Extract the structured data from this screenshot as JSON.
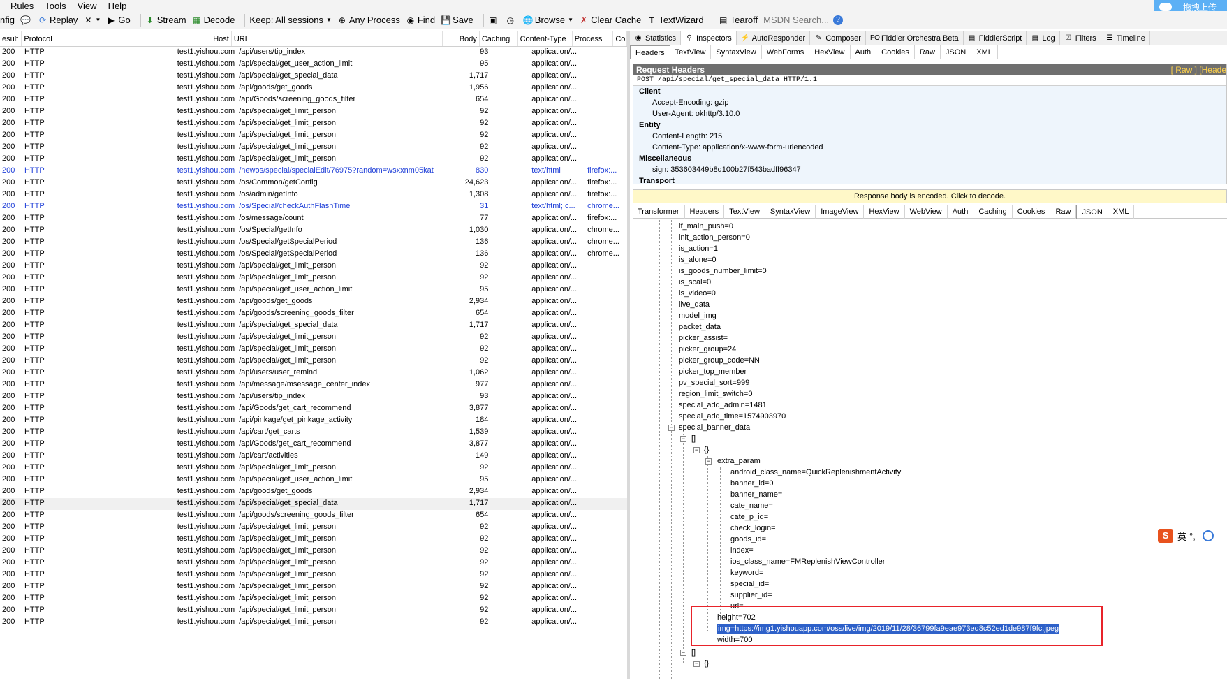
{
  "menu": [
    "Rules",
    "Tools",
    "View",
    "Help"
  ],
  "upload_label": "拖拽上传",
  "toolbar": {
    "config": "nfig",
    "replay": "Replay",
    "go": "Go",
    "stream": "Stream",
    "decode": "Decode",
    "keep": "Keep: All sessions",
    "process": "Any Process",
    "find": "Find",
    "save": "Save",
    "browse": "Browse",
    "clear_cache": "Clear Cache",
    "textwizard": "TextWizard",
    "tearoff": "Tearoff",
    "search_placeholder": "MSDN Search..."
  },
  "grid": {
    "headers": [
      "esult",
      "Protocol",
      "Host",
      "URL",
      "Body",
      "Caching",
      "Content-Type",
      "Process",
      "Cor"
    ],
    "rows": [
      [
        "200",
        "HTTP",
        "test1.yishou.com",
        "/api/users/tip_index",
        "93",
        "",
        "application/...",
        ""
      ],
      [
        "200",
        "HTTP",
        "test1.yishou.com",
        "/api/special/get_user_action_limit",
        "95",
        "",
        "application/...",
        ""
      ],
      [
        "200",
        "HTTP",
        "test1.yishou.com",
        "/api/special/get_special_data",
        "1,717",
        "",
        "application/...",
        ""
      ],
      [
        "200",
        "HTTP",
        "test1.yishou.com",
        "/api/goods/get_goods",
        "1,956",
        "",
        "application/...",
        ""
      ],
      [
        "200",
        "HTTP",
        "test1.yishou.com",
        "/api/Goods/screening_goods_filter",
        "654",
        "",
        "application/...",
        ""
      ],
      [
        "200",
        "HTTP",
        "test1.yishou.com",
        "/api/special/get_limit_person",
        "92",
        "",
        "application/...",
        ""
      ],
      [
        "200",
        "HTTP",
        "test1.yishou.com",
        "/api/special/get_limit_person",
        "92",
        "",
        "application/...",
        ""
      ],
      [
        "200",
        "HTTP",
        "test1.yishou.com",
        "/api/special/get_limit_person",
        "92",
        "",
        "application/...",
        ""
      ],
      [
        "200",
        "HTTP",
        "test1.yishou.com",
        "/api/special/get_limit_person",
        "92",
        "",
        "application/...",
        ""
      ],
      [
        "200",
        "HTTP",
        "test1.yishou.com",
        "/api/special/get_limit_person",
        "92",
        "",
        "application/...",
        ""
      ],
      [
        "200",
        "HTTP",
        "test1.yishou.com",
        "/newos/special/specialEdit/76975?random=wsxxnm05kat",
        "830",
        "",
        "text/html",
        "firefox:..."
      ],
      [
        "200",
        "HTTP",
        "test1.yishou.com",
        "/os/Common/getConfig",
        "24,623",
        "",
        "application/...",
        "firefox:..."
      ],
      [
        "200",
        "HTTP",
        "test1.yishou.com",
        "/os/admin/getInfo",
        "1,308",
        "",
        "application/...",
        "firefox:..."
      ],
      [
        "200",
        "HTTP",
        "test1.yishou.com",
        "/os/Special/checkAuthFlashTime",
        "31",
        "",
        "text/html; c...",
        "chrome..."
      ],
      [
        "200",
        "HTTP",
        "test1.yishou.com",
        "/os/message/count",
        "77",
        "",
        "application/...",
        "firefox:..."
      ],
      [
        "200",
        "HTTP",
        "test1.yishou.com",
        "/os/Special/getInfo",
        "1,030",
        "",
        "application/...",
        "chrome..."
      ],
      [
        "200",
        "HTTP",
        "test1.yishou.com",
        "/os/Special/getSpecialPeriod",
        "136",
        "",
        "application/...",
        "chrome..."
      ],
      [
        "200",
        "HTTP",
        "test1.yishou.com",
        "/os/Special/getSpecialPeriod",
        "136",
        "",
        "application/...",
        "chrome..."
      ],
      [
        "200",
        "HTTP",
        "test1.yishou.com",
        "/api/special/get_limit_person",
        "92",
        "",
        "application/...",
        ""
      ],
      [
        "200",
        "HTTP",
        "test1.yishou.com",
        "/api/special/get_limit_person",
        "92",
        "",
        "application/...",
        ""
      ],
      [
        "200",
        "HTTP",
        "test1.yishou.com",
        "/api/special/get_user_action_limit",
        "95",
        "",
        "application/...",
        ""
      ],
      [
        "200",
        "HTTP",
        "test1.yishou.com",
        "/api/goods/get_goods",
        "2,934",
        "",
        "application/...",
        ""
      ],
      [
        "200",
        "HTTP",
        "test1.yishou.com",
        "/api/goods/screening_goods_filter",
        "654",
        "",
        "application/...",
        ""
      ],
      [
        "200",
        "HTTP",
        "test1.yishou.com",
        "/api/special/get_special_data",
        "1,717",
        "",
        "application/...",
        ""
      ],
      [
        "200",
        "HTTP",
        "test1.yishou.com",
        "/api/special/get_limit_person",
        "92",
        "",
        "application/...",
        ""
      ],
      [
        "200",
        "HTTP",
        "test1.yishou.com",
        "/api/special/get_limit_person",
        "92",
        "",
        "application/...",
        ""
      ],
      [
        "200",
        "HTTP",
        "test1.yishou.com",
        "/api/special/get_limit_person",
        "92",
        "",
        "application/...",
        ""
      ],
      [
        "200",
        "HTTP",
        "test1.yishou.com",
        "/api/users/user_remind",
        "1,062",
        "",
        "application/...",
        ""
      ],
      [
        "200",
        "HTTP",
        "test1.yishou.com",
        "/api/message/msessage_center_index",
        "977",
        "",
        "application/...",
        ""
      ],
      [
        "200",
        "HTTP",
        "test1.yishou.com",
        "/api/users/tip_index",
        "93",
        "",
        "application/...",
        ""
      ],
      [
        "200",
        "HTTP",
        "test1.yishou.com",
        "/api/Goods/get_cart_recommend",
        "3,877",
        "",
        "application/...",
        ""
      ],
      [
        "200",
        "HTTP",
        "test1.yishou.com",
        "/api/pinkage/get_pinkage_activity",
        "184",
        "",
        "application/...",
        ""
      ],
      [
        "200",
        "HTTP",
        "test1.yishou.com",
        "/api/cart/get_carts",
        "1,539",
        "",
        "application/...",
        ""
      ],
      [
        "200",
        "HTTP",
        "test1.yishou.com",
        "/api/Goods/get_cart_recommend",
        "3,877",
        "",
        "application/...",
        ""
      ],
      [
        "200",
        "HTTP",
        "test1.yishou.com",
        "/api/cart/activities",
        "149",
        "",
        "application/...",
        ""
      ],
      [
        "200",
        "HTTP",
        "test1.yishou.com",
        "/api/special/get_limit_person",
        "92",
        "",
        "application/...",
        ""
      ],
      [
        "200",
        "HTTP",
        "test1.yishou.com",
        "/api/special/get_user_action_limit",
        "95",
        "",
        "application/...",
        ""
      ],
      [
        "200",
        "HTTP",
        "test1.yishou.com",
        "/api/goods/get_goods",
        "2,934",
        "",
        "application/...",
        ""
      ],
      [
        "200",
        "HTTP",
        "test1.yishou.com",
        "/api/special/get_special_data",
        "1,717",
        "",
        "application/...",
        ""
      ],
      [
        "200",
        "HTTP",
        "test1.yishou.com",
        "/api/goods/screening_goods_filter",
        "654",
        "",
        "application/...",
        ""
      ],
      [
        "200",
        "HTTP",
        "test1.yishou.com",
        "/api/special/get_limit_person",
        "92",
        "",
        "application/...",
        ""
      ],
      [
        "200",
        "HTTP",
        "test1.yishou.com",
        "/api/special/get_limit_person",
        "92",
        "",
        "application/...",
        ""
      ],
      [
        "200",
        "HTTP",
        "test1.yishou.com",
        "/api/special/get_limit_person",
        "92",
        "",
        "application/...",
        ""
      ],
      [
        "200",
        "HTTP",
        "test1.yishou.com",
        "/api/special/get_limit_person",
        "92",
        "",
        "application/...",
        ""
      ],
      [
        "200",
        "HTTP",
        "test1.yishou.com",
        "/api/special/get_limit_person",
        "92",
        "",
        "application/...",
        ""
      ],
      [
        "200",
        "HTTP",
        "test1.yishou.com",
        "/api/special/get_limit_person",
        "92",
        "",
        "application/...",
        ""
      ],
      [
        "200",
        "HTTP",
        "test1.yishou.com",
        "/api/special/get_limit_person",
        "92",
        "",
        "application/...",
        ""
      ],
      [
        "200",
        "HTTP",
        "test1.yishou.com",
        "/api/special/get_limit_person",
        "92",
        "",
        "application/...",
        ""
      ],
      [
        "200",
        "HTTP",
        "test1.yishou.com",
        "/api/special/get_limit_person",
        "92",
        "",
        "application/...",
        ""
      ]
    ],
    "blue_rows": [
      10,
      13
    ],
    "selected_row": 38
  },
  "top_tabs": [
    "Statistics",
    "Inspectors",
    "AutoResponder",
    "Composer",
    "Fiddler Orchestra Beta",
    "FiddlerScript",
    "Log",
    "Filters",
    "Timeline"
  ],
  "request_tabs": [
    "Headers",
    "TextView",
    "SyntaxView",
    "WebForms",
    "HexView",
    "Auth",
    "Cookies",
    "Raw",
    "JSON",
    "XML"
  ],
  "request": {
    "title": "Request Headers",
    "links": "[ Raw ]  [Heade",
    "line": "POST /api/special/get_special_data HTTP/1.1",
    "client_label": "Client",
    "client": [
      "Accept-Encoding: gzip",
      "User-Agent: okhttp/3.10.0"
    ],
    "entity_label": "Entity",
    "entity": [
      "Content-Length: 215",
      "Content-Type: application/x-www-form-urlencoded"
    ],
    "misc_label": "Miscellaneous",
    "misc": [
      "sign: 353603449b8d100b27f543badff96347"
    ],
    "transport_label": "Transport"
  },
  "response_bar": "Response body is encoded. Click to decode.",
  "response_tabs": [
    "Transformer",
    "Headers",
    "TextView",
    "SyntaxView",
    "ImageView",
    "HexView",
    "WebView",
    "Auth",
    "Caching",
    "Cookies",
    "Raw",
    "JSON",
    "XML"
  ],
  "tree": [
    "if_main_push=0",
    "init_action_person=0",
    "is_action=1",
    "is_alone=0",
    "is_goods_number_limit=0",
    "is_scal=0",
    "is_video=0",
    "live_data",
    "model_img",
    "packet_data",
    "picker_assist=",
    "picker_group=24",
    "picker_group_code=NN",
    "picker_top_member",
    "pv_special_sort=999",
    "region_limit_switch=0",
    "special_add_admin=1481",
    "special_add_time=1574903970",
    "special_banner_data"
  ],
  "tree_arr": "[]",
  "tree_obj": "{}",
  "extra_param_label": "extra_param",
  "extra_param": [
    "android_class_name=QuickReplenishmentActivity",
    "banner_id=0",
    "banner_name=",
    "cate_name=",
    "cate_p_id=",
    "check_login=",
    "goods_id=",
    "index=",
    "ios_class_name=FMReplenishViewController",
    "keyword=",
    "special_id=",
    "supplier_id=",
    "url="
  ],
  "height": "height=702",
  "img": "img=https://img1.yishouapp.com/oss/live/img/2019/11/28/36799fa9eae973ed8c52ed1de987f9fc.jpeg",
  "width": "width=700",
  "ime_label": "英"
}
